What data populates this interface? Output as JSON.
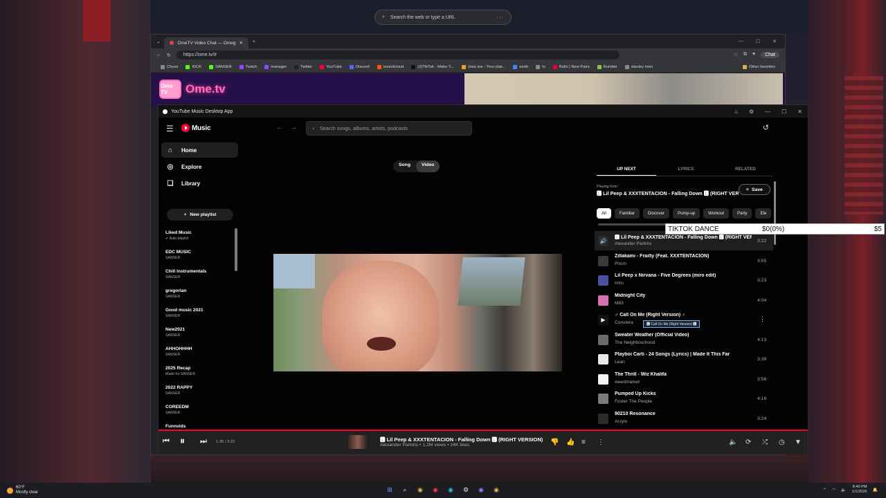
{
  "desktop": {
    "search_placeholder": "Search the web or type a URL",
    "search_menu": "···"
  },
  "browser": {
    "tab_title": "OmeTV Video Chat — Omeg",
    "url": "https://ome.tv/#",
    "chat_label": "Chat",
    "bookmarks": [
      "Chess",
      "KICK",
      "SANSER",
      "Twitch",
      "manager",
      "Twitter",
      "YouTube",
      "Discord",
      "soundcloud",
      "(3)TikTok - Make Y...",
      "Jeez.me - Your plat...",
      "earth",
      "lo",
      "Bullx | New Pairs",
      "Rumble",
      "stanley horn"
    ],
    "other_favorites": "Other favorites",
    "ome_logo_badge": "Ome TV",
    "ome_logo_text": "Ome.tv"
  },
  "ytm": {
    "window_title": "YouTube Music Desktop App",
    "brand": "Music",
    "search_placeholder": "Search songs, albums, artists, podcasts",
    "nav": [
      {
        "label": "Home",
        "icon": "home-icon"
      },
      {
        "label": "Explore",
        "icon": "explore-icon"
      },
      {
        "label": "Library",
        "icon": "library-icon"
      }
    ],
    "new_playlist": "New playlist",
    "playlists": [
      {
        "name": "Liked Music",
        "sub": "✔ Auto playlist"
      },
      {
        "name": "EDC MUSIC",
        "sub": "SANSER"
      },
      {
        "name": "Chill Instrumentals",
        "sub": "SANSER"
      },
      {
        "name": "gregorian",
        "sub": "SANSER"
      },
      {
        "name": "Good music 2021",
        "sub": "SANSER"
      },
      {
        "name": "New2021",
        "sub": "SANSER"
      },
      {
        "name": "AHHOHHHH",
        "sub": "SANSER"
      },
      {
        "name": "2025 Recap",
        "sub": "Made for SANSER"
      },
      {
        "name": "2022 RAPPY",
        "sub": "SANSER"
      },
      {
        "name": "COREEDM",
        "sub": "SANSER"
      },
      {
        "name": "Funnvids",
        "sub": ""
      }
    ],
    "toggle": {
      "song": "Song",
      "video": "Video"
    },
    "tabs": {
      "up_next": "UP NEXT",
      "lyrics": "LYRICS",
      "related": "RELATED"
    },
    "playing_from_label": "Playing from",
    "playing_from_title": "🅻 Lil Peep & XXXTENTACION - Falling Down 🅻 (RIGHT VERSION)",
    "save_label": "Save",
    "chips": [
      "All",
      "Familiar",
      "Discover",
      "Pump-up",
      "Workout",
      "Party",
      "Ele"
    ],
    "queue": [
      {
        "title": "🅻 Lil Peep & XXXTENTACION - Falling Down 🅻 (RIGHT VERSION)",
        "artist": "Alexander Parkins",
        "duration": "3:22"
      },
      {
        "title": "Zillakami - Frailty (Feat. XXXTENTACION)",
        "artist": "Prism",
        "duration": "3:55"
      },
      {
        "title": "Lil Peep x Nirvana - Five Degrees (miro edit)",
        "artist": "miro",
        "duration": "3:23"
      },
      {
        "title": "Midnight City",
        "artist": "M83",
        "duration": "4:04"
      },
      {
        "title": "♂ Call On Me (Right Version) ♂",
        "artist": "Constera",
        "duration": ""
      },
      {
        "title": "Sweater Weather (Official Video)",
        "artist": "The Neighbourhood",
        "duration": "4:13"
      },
      {
        "title": "Playboi Carti - 24 Songs (Lyrics) | Made It This Far",
        "artist": "Lean",
        "duration": "3:39"
      },
      {
        "title": "The Thrill - Wiz Khalifa",
        "artist": "weedmarket",
        "duration": "3:56"
      },
      {
        "title": "Pumped Up Kicks",
        "artist": "Foster The People",
        "duration": "4:16"
      },
      {
        "title": "90210 Resonance",
        "artist": "Acrylo",
        "duration": "3:24"
      }
    ],
    "hover_tooltip": "🅻 Call On Me (Right Version) 🅻",
    "player": {
      "time": "1:35 / 3:22",
      "progress": 0.47,
      "title": "🅻 Lil Peep & XXXTENTACION - Falling Down 🅻 (RIGHT VERSION)",
      "subtitle": "Alexander Parkins • 1.2M views • 24K likes"
    }
  },
  "overlay": {
    "label": "TIKTOK DANCE",
    "amount": "$0(0%)",
    "goal": "$5"
  },
  "taskbar": {
    "temp": "60°F",
    "weather": "Mostly clear",
    "time": "8:40 PM",
    "date": "1/1/2026"
  },
  "colors": {
    "accent": "#ff0033",
    "panel": "#212121",
    "bg": "#030303"
  }
}
